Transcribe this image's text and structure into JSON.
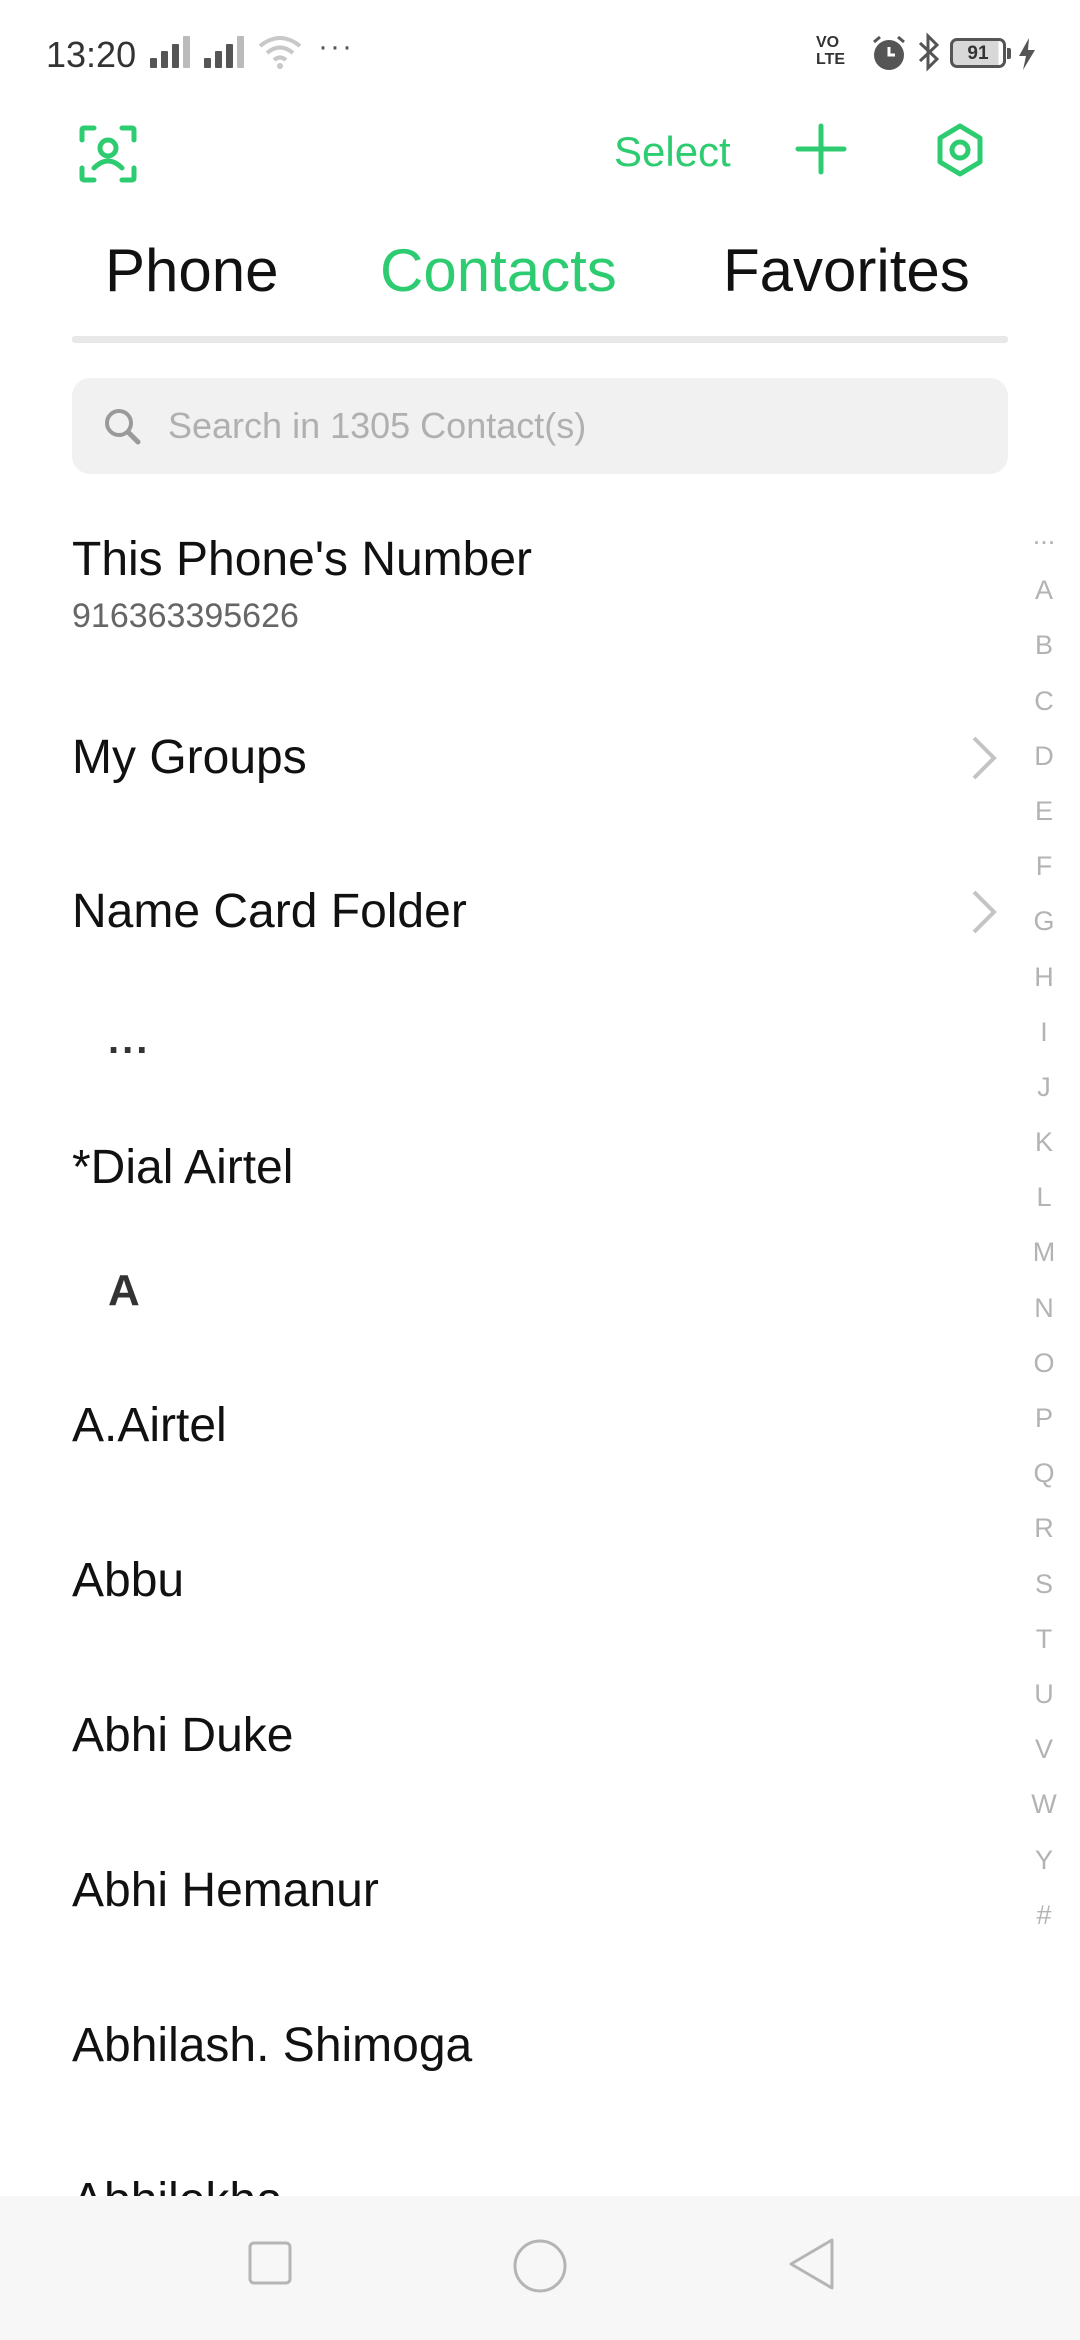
{
  "status_bar": {
    "time": "13:20",
    "more": "···",
    "volte": "VO\nLTE",
    "battery_level": "91",
    "battery_fraction": 0.91
  },
  "toolbar": {
    "select_label": "Select",
    "accent_color": "#2ecc71"
  },
  "tabs": [
    {
      "label": "Phone",
      "active": false
    },
    {
      "label": "Contacts",
      "active": true
    },
    {
      "label": "Favorites",
      "active": false
    }
  ],
  "search": {
    "placeholder": "Search in 1305 Contact(s)",
    "value": ""
  },
  "header_items": {
    "my_number_title": "This Phone's Number",
    "my_number_value": "916363395626",
    "my_groups": "My Groups",
    "name_card_folder": "Name Card Folder"
  },
  "sections": {
    "dots_header": "...",
    "a_header": "A"
  },
  "contacts": [
    "*Dial Airtel",
    "A.Airtel",
    "Abbu",
    "Abhi Duke",
    "Abhi Hemanur",
    "Abhilash. Shimoga",
    "Abhilekha"
  ],
  "alpha_index": [
    "...",
    "A",
    "B",
    "C",
    "D",
    "E",
    "F",
    "G",
    "H",
    "I",
    "J",
    "K",
    "L",
    "M",
    "N",
    "O",
    "P",
    "Q",
    "R",
    "S",
    "T",
    "U",
    "V",
    "W",
    "Y",
    "#"
  ],
  "icons": {
    "scan": "scan-contact-icon",
    "add": "plus-icon",
    "settings": "settings-icon",
    "search": "search-icon",
    "chevron": "chevron-right-icon",
    "nav_recent": "square-icon",
    "nav_home": "circle-icon",
    "nav_back": "triangle-back-icon"
  }
}
